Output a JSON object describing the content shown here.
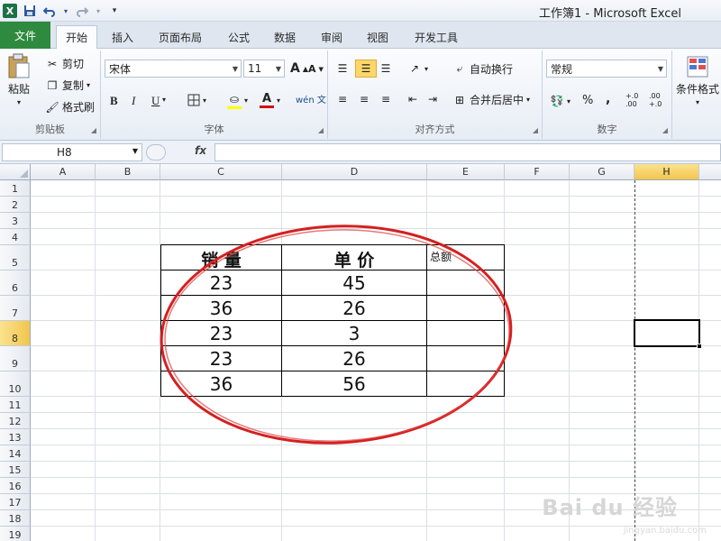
{
  "window": {
    "title": "工作簿1  -  Microsoft Excel",
    "app_icon": "X"
  },
  "quick_access": [
    "save-icon",
    "undo-icon",
    "redo-icon",
    "customize-icon"
  ],
  "tabs": {
    "file": "文件",
    "items": [
      "开始",
      "插入",
      "页面布局",
      "公式",
      "数据",
      "审阅",
      "视图",
      "开发工具"
    ],
    "active_index": 0
  },
  "ribbon": {
    "clipboard": {
      "paste": "粘贴",
      "cut": "剪切",
      "copy": "复制",
      "format_painter": "格式刷",
      "label": "剪贴板"
    },
    "font": {
      "name": "宋体",
      "size": "11",
      "grow": "A",
      "shrink": "A",
      "bold": "B",
      "italic": "I",
      "underline": "U",
      "phonetic": "wén 文",
      "label": "字体"
    },
    "alignment": {
      "wrap": "自动换行",
      "merge": "合并后居中",
      "label": "对齐方式"
    },
    "number": {
      "format": "常规",
      "percent": "%",
      "comma": ",",
      "increase_decimal": "+.0 .00",
      "decrease_decimal": ".00 +.0",
      "label": "数字"
    },
    "styles": {
      "conditional": "条件格式"
    }
  },
  "formula_bar": {
    "name_box": "H8",
    "fx": "fx",
    "value": ""
  },
  "sheet": {
    "columns": [
      "A",
      "B",
      "C",
      "D",
      "E",
      "F",
      "G",
      "H"
    ],
    "rows": [
      "1",
      "2",
      "3",
      "4",
      "5",
      "6",
      "7",
      "8",
      "9",
      "10",
      "11",
      "12",
      "13",
      "14",
      "15",
      "16",
      "17",
      "18",
      "19"
    ],
    "selected_column": "H",
    "selected_row": "8",
    "table": {
      "headers": [
        "销 量",
        "单 价",
        "总额"
      ],
      "rows": [
        [
          "23",
          "45",
          ""
        ],
        [
          "36",
          "26",
          ""
        ],
        [
          "23",
          "3",
          ""
        ],
        [
          "23",
          "26",
          ""
        ],
        [
          "36",
          "56",
          ""
        ]
      ]
    },
    "annotation_color": "#d42020"
  },
  "watermark": {
    "text": "Bai du 经验",
    "url": "jingyan.baidu.com"
  }
}
